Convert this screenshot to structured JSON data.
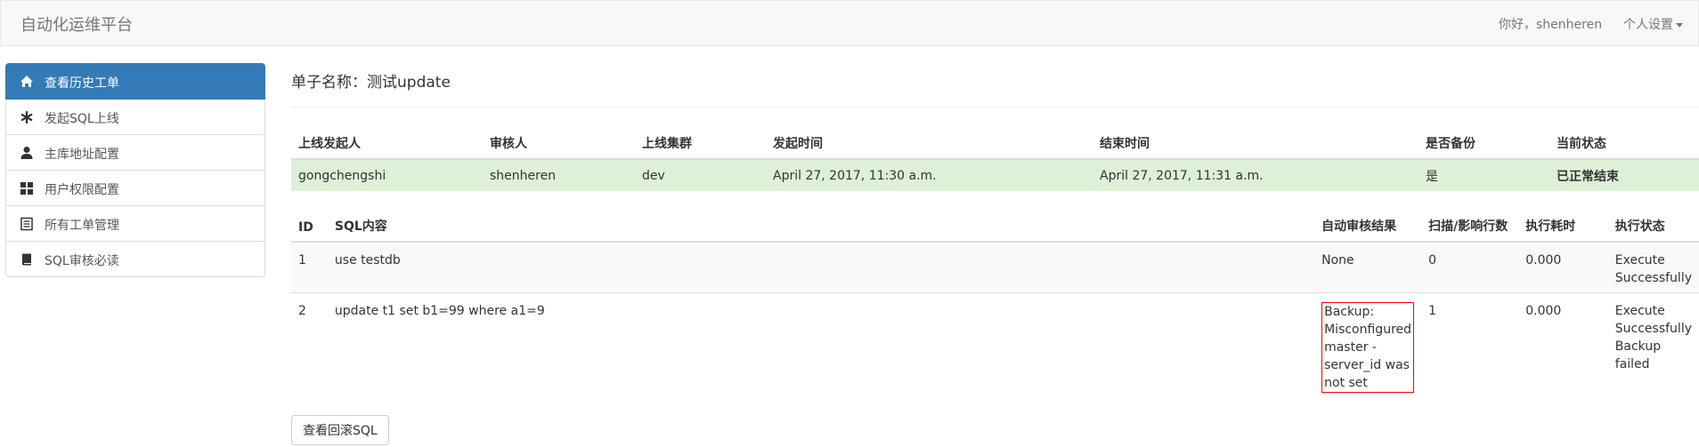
{
  "app": {
    "brand": "自动化运维平台"
  },
  "navbar": {
    "greeting": "你好，shenheren",
    "settings_label": "个人设置"
  },
  "sidebar": {
    "items": [
      {
        "label": "查看历史工单",
        "icon": "home-icon",
        "active": true
      },
      {
        "label": "发起SQL上线",
        "icon": "asterisk-icon",
        "active": false
      },
      {
        "label": "主库地址配置",
        "icon": "user-icon",
        "active": false
      },
      {
        "label": "用户权限配置",
        "icon": "grid-icon",
        "active": false
      },
      {
        "label": "所有工单管理",
        "icon": "list-alt-icon",
        "active": false
      },
      {
        "label": "SQL审核必读",
        "icon": "book-icon",
        "active": false
      }
    ]
  },
  "main": {
    "title": "单子名称：测试update",
    "workflow_table": {
      "headers": [
        "上线发起人",
        "审核人",
        "上线集群",
        "发起时间",
        "结束时间",
        "是否备份",
        "当前状态"
      ],
      "row": {
        "engineer": "gongchengshi",
        "reviewer": "shenheren",
        "cluster": "dev",
        "create_time": "April 27, 2017, 11:30 a.m.",
        "finish_time": "April 27, 2017, 11:31 a.m.",
        "backup": "是",
        "status": "已正常结束"
      }
    },
    "sql_table": {
      "headers": [
        "ID",
        "SQL内容",
        "自动审核结果",
        "扫描/影响行数",
        "执行耗时",
        "执行状态"
      ],
      "rows": [
        {
          "id": "1",
          "sql": "use testdb",
          "audit": "None",
          "affected": "0",
          "time": "0.000",
          "status": "Execute Successfully"
        },
        {
          "id": "2",
          "sql": "update t1 set b1=99 where a1=9",
          "audit": "Backup: Misconfigured master - server_id was not set",
          "affected": "1",
          "time": "0.000",
          "status": "Execute Successfully Backup failed"
        }
      ]
    },
    "rollback_button": "查看回滚SQL"
  },
  "colors": {
    "primary": "#337ab7",
    "success_bg": "#dff0d8",
    "danger": "#ff0000"
  }
}
